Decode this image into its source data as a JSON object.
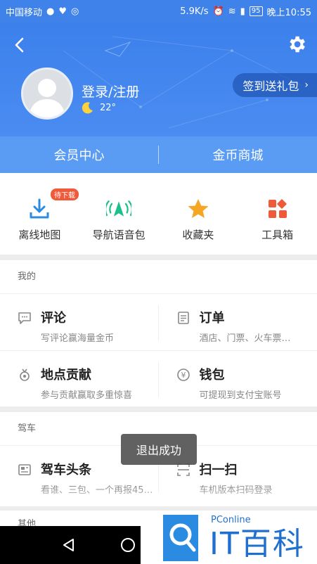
{
  "status_bar": {
    "carrier": "中国移动",
    "speed": "5.9K/s",
    "battery": "95",
    "time": "晚上10:55"
  },
  "header": {
    "login_label": "登录/注册",
    "temperature": "22°",
    "checkin_label": "签到送礼包"
  },
  "member_bar": {
    "member_center": "会员中心",
    "gold_mall": "金币商城"
  },
  "quick_actions": [
    {
      "label": "离线地图",
      "badge": "待下载",
      "icon": "download-icon"
    },
    {
      "label": "导航语音包",
      "icon": "voice-navigation-icon"
    },
    {
      "label": "收藏夹",
      "icon": "star-icon"
    },
    {
      "label": "工具箱",
      "icon": "toolbox-icon"
    }
  ],
  "mine_section": {
    "title": "我的",
    "items": [
      {
        "title": "评论",
        "sub": "写评论赢海量金币",
        "icon": "comment-icon"
      },
      {
        "title": "订单",
        "sub": "酒店、门票、火车票…",
        "icon": "order-icon"
      },
      {
        "title": "地点贡献",
        "sub": "参与贡献赢取多重惊喜",
        "icon": "contribution-icon"
      },
      {
        "title": "钱包",
        "sub": "可提现到支付宝账号",
        "icon": "wallet-icon"
      }
    ]
  },
  "driving_section": {
    "title": "驾车",
    "items": [
      {
        "title": "驾车头条",
        "sub": "看谁、三包、一个再报45…",
        "icon": "news-icon"
      },
      {
        "title": "扫一扫",
        "sub": "车机版本扫码登录",
        "icon": "scan-icon"
      }
    ]
  },
  "other_section": {
    "title": "其他"
  },
  "toast": {
    "text": "退出成功"
  },
  "watermark": {
    "brand": "PConline",
    "text": "IT百科"
  },
  "colors": {
    "primary": "#3f82e9",
    "member_bar": "#5a9cf4",
    "badge": "#f05a3a",
    "star": "#f5a623",
    "voice": "#1dbf8c",
    "toolbox": "#ef5a3a"
  }
}
